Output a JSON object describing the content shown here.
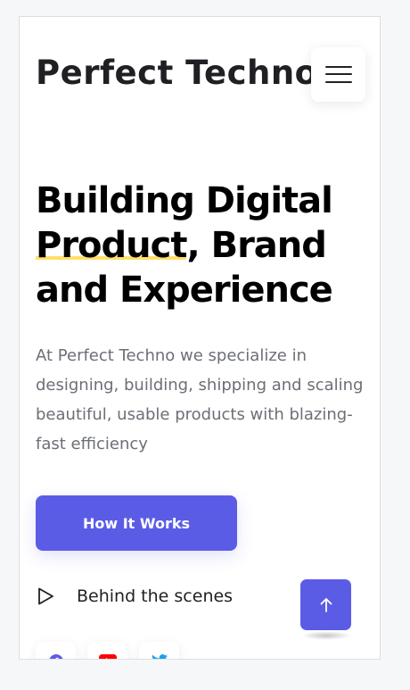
{
  "header": {
    "brand": "Perfect Techno",
    "menu_icon": "hamburger-menu-icon"
  },
  "hero": {
    "headline_part1": "Building Digital",
    "headline_highlight": "Product",
    "headline_part2": ", Brand",
    "headline_part3": "and Experience",
    "description": "At Perfect Techno we specialize in designing, building, shipping and scaling beautiful, usable products with blazing-fast efficiency",
    "cta_label": "How It Works",
    "video_link_label": "Behind the scenes"
  },
  "socials": [
    {
      "icon": "facebook-icon",
      "color": "#5b5ce6"
    },
    {
      "icon": "youtube-icon",
      "color": "#ff0000"
    },
    {
      "icon": "twitter-icon",
      "color": "#1da1f2"
    }
  ],
  "scroll_top_icon": "arrow-up-icon",
  "colors": {
    "accent": "#5b5ce6",
    "highlight": "#ffe06b",
    "text_dark": "#1f1f24",
    "text_muted": "#6b6f76"
  }
}
